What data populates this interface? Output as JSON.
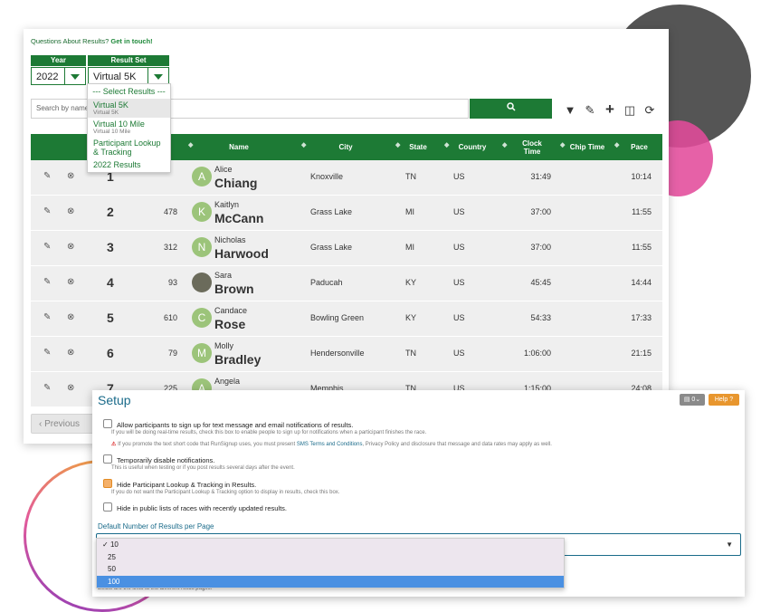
{
  "header": {
    "question_text": "Questions About Results?",
    "contact_link": "Get in touch!"
  },
  "year": {
    "label": "Year",
    "value": "2022"
  },
  "result_set": {
    "label": "Result Set",
    "value": "Virtual 5K"
  },
  "dropdown": {
    "header": "--- Select Results ---",
    "items": [
      {
        "label": "Virtual 5K",
        "sub": "Virtual 5K"
      },
      {
        "label": "Virtual 10 Mile",
        "sub": "Virtual 10 Mile"
      },
      {
        "label": "Participant Lookup & Tracking",
        "sub": ""
      },
      {
        "label": "2022 Results",
        "sub": ""
      }
    ]
  },
  "search": {
    "placeholder": "Search by name",
    "button_icon": "search-icon"
  },
  "toolbar_icons": [
    "filter-icon",
    "edit-icon",
    "plus-icon",
    "columns-icon",
    "refresh-icon"
  ],
  "table": {
    "columns": [
      "Name",
      "City",
      "State",
      "Country",
      "Clock Time",
      "Chip Time",
      "Pace"
    ],
    "rows": [
      {
        "place": "1",
        "bib": "",
        "initial": "A",
        "first": "Alice",
        "last": "Chiang",
        "city": "Knoxville",
        "state": "TN",
        "country": "US",
        "clock": "31:49",
        "pace": "10:14"
      },
      {
        "place": "2",
        "bib": "478",
        "initial": "K",
        "first": "Kaitlyn",
        "last": "McCann",
        "city": "Grass Lake",
        "state": "MI",
        "country": "US",
        "clock": "37:00",
        "pace": "11:55"
      },
      {
        "place": "3",
        "bib": "312",
        "initial": "N",
        "first": "Nicholas",
        "last": "Harwood",
        "city": "Grass Lake",
        "state": "MI",
        "country": "US",
        "clock": "37:00",
        "pace": "11:55"
      },
      {
        "place": "4",
        "bib": "93",
        "initial": "",
        "first": "Sara",
        "last": "Brown",
        "city": "Paducah",
        "state": "KY",
        "country": "US",
        "clock": "45:45",
        "pace": "14:44"
      },
      {
        "place": "5",
        "bib": "610",
        "initial": "C",
        "first": "Candace",
        "last": "Rose",
        "city": "Bowling Green",
        "state": "KY",
        "country": "US",
        "clock": "54:33",
        "pace": "17:33"
      },
      {
        "place": "6",
        "bib": "79",
        "initial": "M",
        "first": "Molly",
        "last": "Bradley",
        "city": "Hendersonville",
        "state": "TN",
        "country": "US",
        "clock": "1:06:00",
        "pace": "21:15"
      },
      {
        "place": "7",
        "bib": "225",
        "initial": "A",
        "first": "Angela",
        "last": "",
        "city": "Memphis",
        "state": "TN",
        "country": "US",
        "clock": "1:15:00",
        "pace": "24:08"
      }
    ]
  },
  "pagination": {
    "prev_label": "Previous"
  },
  "setup": {
    "title": "Setup",
    "counter_label": "0",
    "help_label": "Help",
    "options": [
      {
        "label": "Allow participants to sign up for text message and email notifications of results.",
        "hint": "If you will be doing real-time results, check this box to enable people to sign up for notifications when a participant finishes the race.",
        "checked": false
      },
      {
        "label": "Temporarily disable notifications.",
        "hint": "This is useful when testing or if you post results several days after the event.",
        "checked": false
      },
      {
        "label": "Hide Participant Lookup & Tracking in Results.",
        "hint": "If you do not want the Participant Lookup & Tracking option to display in results, check this box.",
        "checked": true
      },
      {
        "label": "Hide in public lists of races with recently updated results.",
        "hint": "",
        "checked": false
      }
    ],
    "warning_pre": "If you promote the text short code that RunSignup uses, you must present",
    "warning_link": "SMS Terms and Conditions",
    "warning_post": ", Privacy Policy and disclosure that message and data rates may apply as well.",
    "per_page_label": "Default Number of Results per Page",
    "per_page_options": [
      "10",
      "25",
      "50",
      "100"
    ],
    "per_page_selected": "10",
    "per_page_highlighted": "100",
    "below_text": "Below are the links to the different result pages."
  },
  "colors": {
    "brand_green": "#1d7a35",
    "setup_blue": "#1a6b8a",
    "help_orange": "#e8962e",
    "highlight_blue": "#4a90e2"
  }
}
